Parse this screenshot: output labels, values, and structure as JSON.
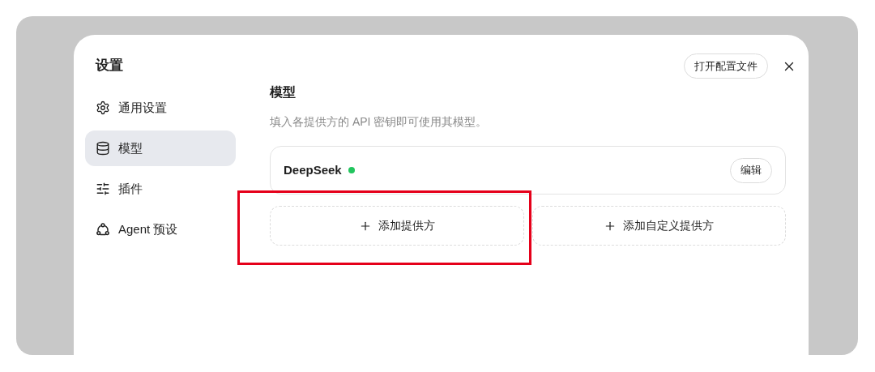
{
  "dialog": {
    "title": "设置",
    "open_config_button": "打开配置文件"
  },
  "sidebar": {
    "items": [
      {
        "label": "通用设置",
        "kind": "gear",
        "selected": false
      },
      {
        "label": "模型",
        "kind": "database",
        "selected": true
      },
      {
        "label": "插件",
        "kind": "sliders",
        "selected": false
      },
      {
        "label": "Agent 预设",
        "kind": "nodes",
        "selected": false
      }
    ]
  },
  "section": {
    "title": "模型",
    "description": "填入各提供方的 API 密钥即可使用其模型。"
  },
  "providers": [
    {
      "name": "DeepSeek",
      "color": "#22c55e",
      "edit_button": "编辑"
    }
  ],
  "add_buttons": [
    {
      "label": "添加提供方",
      "highlighted": true
    },
    {
      "label": "添加自定义提供方",
      "highlighted": false
    }
  ]
}
